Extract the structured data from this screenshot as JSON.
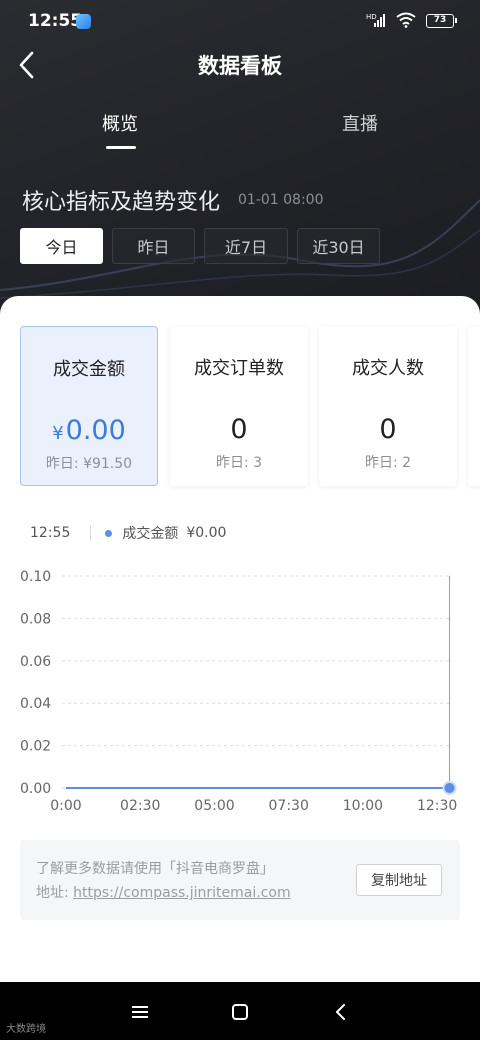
{
  "status_bar": {
    "time": "12:55",
    "battery": "73",
    "network": "HD"
  },
  "header": {
    "title": "数据看板",
    "tabs": [
      {
        "label": "概览"
      },
      {
        "label": "直播"
      }
    ]
  },
  "section": {
    "title": "核心指标及趋势变化",
    "time": "01-01 08:00"
  },
  "ranges": [
    {
      "label": "今日"
    },
    {
      "label": "昨日"
    },
    {
      "label": "近7日"
    },
    {
      "label": "近30日"
    }
  ],
  "metrics": [
    {
      "label": "成交金额",
      "currency": "¥",
      "value": "0.00",
      "prev": "昨日: ¥91.50"
    },
    {
      "label": "成交订单数",
      "value": "0",
      "prev": "昨日: 3"
    },
    {
      "label": "成交人数",
      "value": "0",
      "prev": "昨日: 2"
    }
  ],
  "legend": {
    "time": "12:55",
    "series": "成交金额",
    "value": "¥0.00"
  },
  "chart_data": {
    "type": "line",
    "x_ticks": [
      "0:00",
      "02:30",
      "05:00",
      "07:30",
      "10:00",
      "12:30"
    ],
    "y_ticks": [
      "0.10",
      "0.08",
      "0.06",
      "0.04",
      "0.02",
      "0.00"
    ],
    "ylim": [
      0,
      0.1
    ],
    "xlim_minutes": [
      0,
      780
    ],
    "x_minutes": [
      0,
      150,
      300,
      450,
      600,
      750,
      775
    ],
    "y": [
      0,
      0,
      0,
      0,
      0,
      0,
      0
    ],
    "grid": "horizontal-dashed",
    "line_color": "#5b8ee6"
  },
  "info": {
    "line1": "了解更多数据请使用「抖音电商罗盘」",
    "address_label": "地址:",
    "link": "https://compass.jinritemai.com",
    "copy_button": "复制地址"
  },
  "watermark": "大数跨境",
  "colors": {
    "accent": "#3d7bd9",
    "dark_bg": "#222328"
  }
}
